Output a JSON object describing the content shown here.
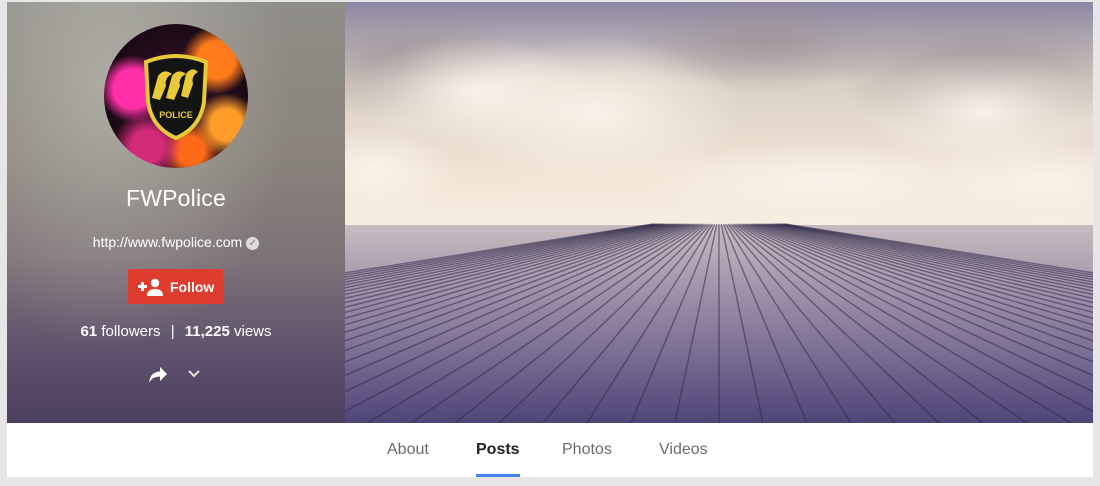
{
  "profile": {
    "name": "FWPolice",
    "website": "http://www.fwpolice.com",
    "verified_icon": "check-circle-icon",
    "follow_label": "Follow",
    "followers_count": "61",
    "followers_label": "followers",
    "views_count": "11,225",
    "views_label": "views",
    "avatar_logo_text": "POLICE"
  },
  "tabs": [
    {
      "label": "About",
      "active": false
    },
    {
      "label": "Posts",
      "active": true
    },
    {
      "label": "Photos",
      "active": false
    },
    {
      "label": "Videos",
      "active": false
    }
  ],
  "colors": {
    "follow_button": "#dd3c2e",
    "active_tab_underline": "#4285f4"
  }
}
